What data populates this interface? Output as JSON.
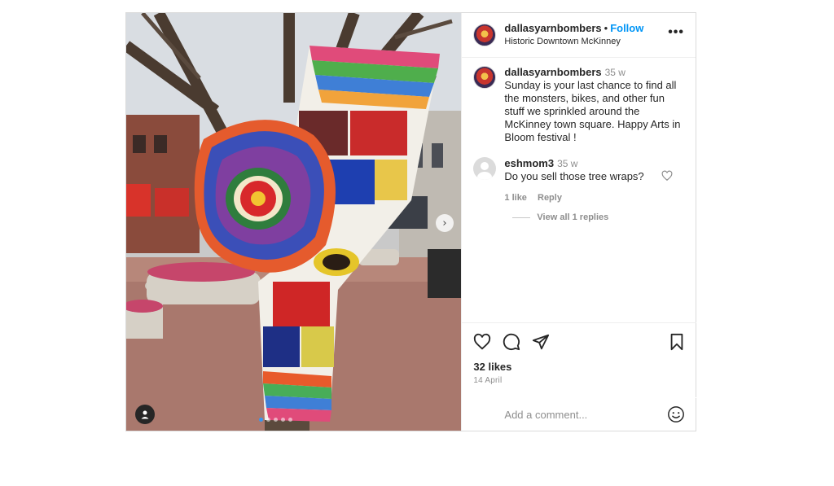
{
  "post": {
    "username": "dallasyarnbombers",
    "follow_label": "Follow",
    "separator": "•",
    "location": "Historic Downtown McKinney",
    "more_label": "•••",
    "next_arrow": "›",
    "carousel": {
      "count": 5,
      "active_index": 0
    }
  },
  "caption": {
    "username": "dallasyarnbombers",
    "time": "35 w",
    "text": "Sunday is your last chance to find all the monsters, bikes, and other fun stuff we sprinkled around the McKinney town square. Happy Arts in Bloom festival !"
  },
  "comments": [
    {
      "username": "eshmom3",
      "time": "35 w",
      "text": "Do you sell those tree wraps?",
      "likes_label": "1 like",
      "reply_label": "Reply",
      "view_replies_label": "View all 1 replies"
    }
  ],
  "actions": {
    "icons": [
      "heart-icon",
      "comment-icon",
      "share-icon",
      "bookmark-icon"
    ],
    "likes": "32 likes",
    "date": "14 April"
  },
  "add_comment": {
    "placeholder": "Add a comment..."
  }
}
